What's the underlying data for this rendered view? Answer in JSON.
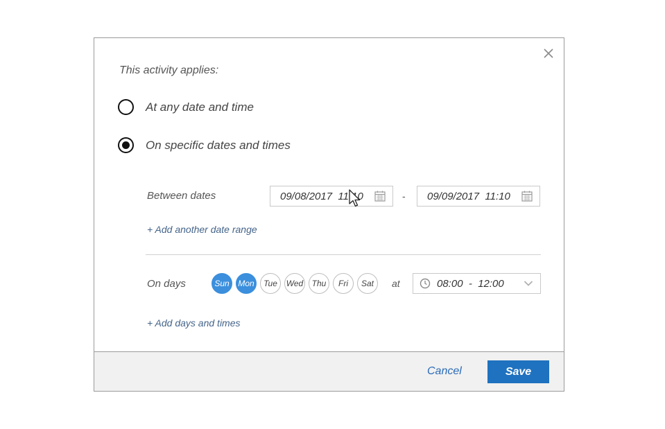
{
  "dialog": {
    "prompt": "This activity applies:",
    "options": [
      {
        "label": "At any date and time",
        "checked": false
      },
      {
        "label": "On specific dates and times",
        "checked": true
      }
    ],
    "between_label": "Between dates",
    "date_start": "09/08/2017  11:10",
    "date_end": "09/09/2017  11:10",
    "dash": "-",
    "add_date_range": "+  Add another date range",
    "days_label": "On days",
    "days": [
      {
        "label": "Sun",
        "selected": true
      },
      {
        "label": "Mon",
        "selected": true
      },
      {
        "label": "Tue",
        "selected": false
      },
      {
        "label": "Wed",
        "selected": false
      },
      {
        "label": "Thu",
        "selected": false
      },
      {
        "label": "Fri",
        "selected": false
      },
      {
        "label": "Sat",
        "selected": false
      }
    ],
    "at_label": "at",
    "time_range": "08:00  -  12:00",
    "add_days_times": "+  Add days and times",
    "cancel_label": "Cancel",
    "save_label": "Save"
  },
  "colors": {
    "accent": "#3b8fdd",
    "save_button": "#1f72bf",
    "link": "#44648a"
  },
  "icons": [
    "close-icon",
    "calendar-icon",
    "clock-icon",
    "chevron-down-icon",
    "mouse-cursor-icon"
  ]
}
